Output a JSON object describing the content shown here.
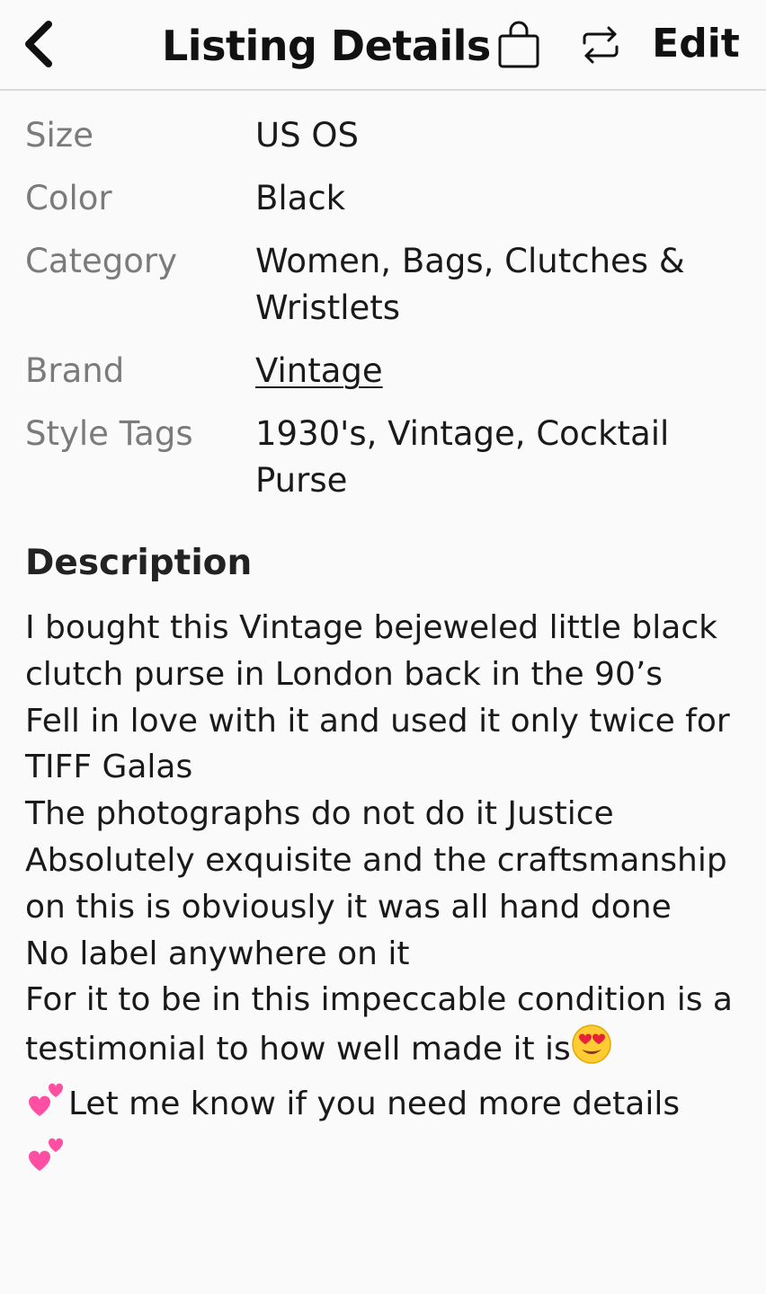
{
  "header": {
    "title": "Listing Details",
    "edit_label": "Edit",
    "back_icon": "chevron-left-icon",
    "bag_icon": "shopping-bag-icon",
    "share_icon": "repost-icon"
  },
  "details": [
    {
      "label": "Size",
      "value": "US OS"
    },
    {
      "label": "Color",
      "value": "Black"
    },
    {
      "label": "Category",
      "value": "Women, Bags, Clutches & Wristlets"
    },
    {
      "label": "Brand",
      "value": "Vintage"
    },
    {
      "label": "Style Tags",
      "value": "1930's, Vintage, Cocktail Purse"
    }
  ],
  "description": {
    "heading": "Description",
    "lines": [
      "I bought this Vintage bejeweled little black clutch purse in London back in the 90’s",
      "Fell in love with it and used it only twice for TIFF Galas",
      "The photographs do not do it Justice",
      "Absolutely exquisite and the craftsmanship on this is obviously it was all hand done",
      "No label anywhere on it",
      "For it to be in this impeccable condition is a testimonial to how well made it is",
      "Let me know if you need more details"
    ]
  },
  "colors": {
    "background": "#fafafa",
    "divider": "#d9d9d9",
    "label": "#7b7b7b",
    "text": "#1a1a1a"
  }
}
